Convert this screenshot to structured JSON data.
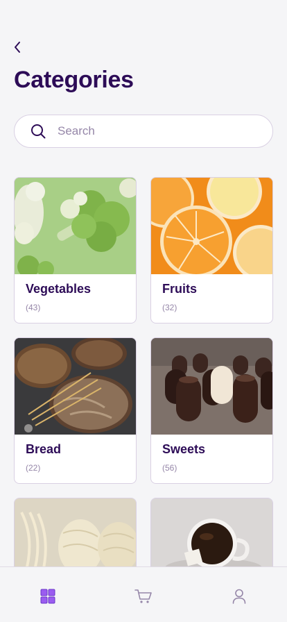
{
  "header": {
    "title": "Categories"
  },
  "search": {
    "placeholder": "Search"
  },
  "categories": [
    {
      "name": "Vegetables",
      "count": "(43)"
    },
    {
      "name": "Fruits",
      "count": "(32)"
    },
    {
      "name": "Bread",
      "count": "(22)"
    },
    {
      "name": "Sweets",
      "count": "(56)"
    },
    {
      "name": "",
      "count": ""
    },
    {
      "name": "",
      "count": ""
    }
  ],
  "tabbar": {
    "items": [
      "grid-icon",
      "cart-icon",
      "user-icon"
    ],
    "active": "grid-icon"
  },
  "colors": {
    "title": "#2d0c57",
    "muted": "#9586a8",
    "accent": "#9b5cf0",
    "border": "#d9d0e3"
  }
}
